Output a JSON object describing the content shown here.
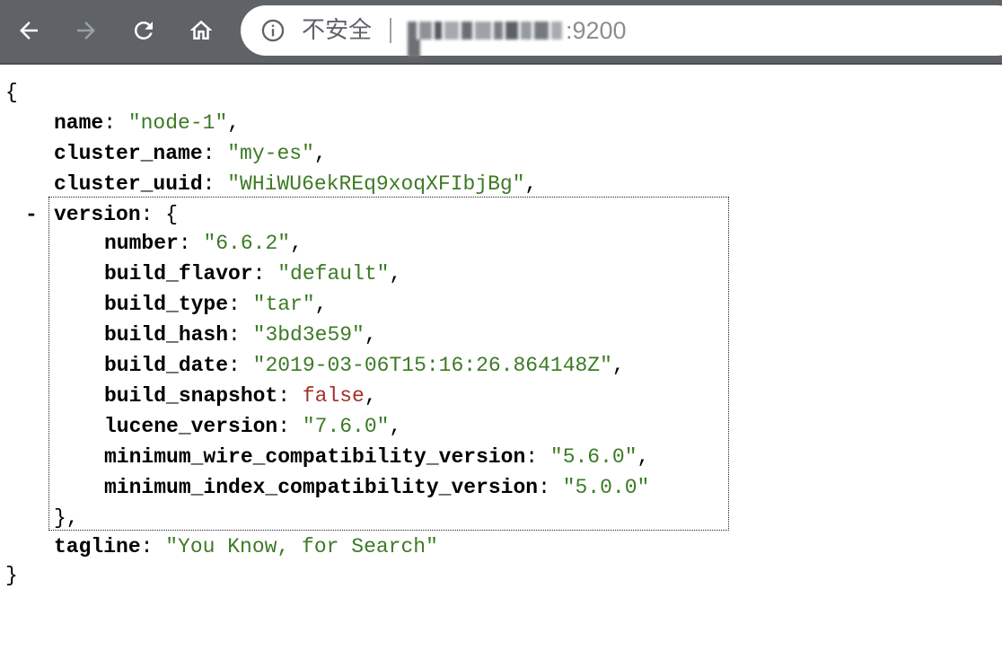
{
  "browser": {
    "security_label": "不安全",
    "url_port": ":9200",
    "nav": {
      "back_icon": "arrow-left-icon",
      "forward_icon": "arrow-right-icon",
      "reload_icon": "reload-icon",
      "home_icon": "home-icon"
    },
    "colors": {
      "toolbar": "#5f6368",
      "omnibox": "#ffffff"
    }
  },
  "json": {
    "open_brace": "{",
    "close_brace": "}",
    "collapse_symbol": "-",
    "fields": {
      "name": {
        "key": "name",
        "value": "\"node-1\""
      },
      "cluster_name": {
        "key": "cluster_name",
        "value": "\"my-es\""
      },
      "cluster_uuid": {
        "key": "cluster_uuid",
        "value": "\"WHiWU6ekREq9xoqXFIbjBg\""
      },
      "version": {
        "key": "version",
        "open": "{",
        "close": "},",
        "number": {
          "key": "number",
          "value": "\"6.6.2\""
        },
        "build_flavor": {
          "key": "build_flavor",
          "value": "\"default\""
        },
        "build_type": {
          "key": "build_type",
          "value": "\"tar\""
        },
        "build_hash": {
          "key": "build_hash",
          "value": "\"3bd3e59\""
        },
        "build_date": {
          "key": "build_date",
          "value": "\"2019-03-06T15:16:26.864148Z\""
        },
        "build_snapshot": {
          "key": "build_snapshot",
          "value": "false"
        },
        "lucene_version": {
          "key": "lucene_version",
          "value": "\"7.6.0\""
        },
        "minimum_wire_compatibility_version": {
          "key": "minimum_wire_compatibility_version",
          "value": "\"5.6.0\""
        },
        "minimum_index_compatibility_version": {
          "key": "minimum_index_compatibility_version",
          "value": "\"5.0.0\""
        }
      },
      "tagline": {
        "key": "tagline",
        "value": "\"You Know, for Search\""
      }
    },
    "colors": {
      "key": "#000000",
      "string": "#3d7a25",
      "boolean": "#a3302a"
    }
  }
}
